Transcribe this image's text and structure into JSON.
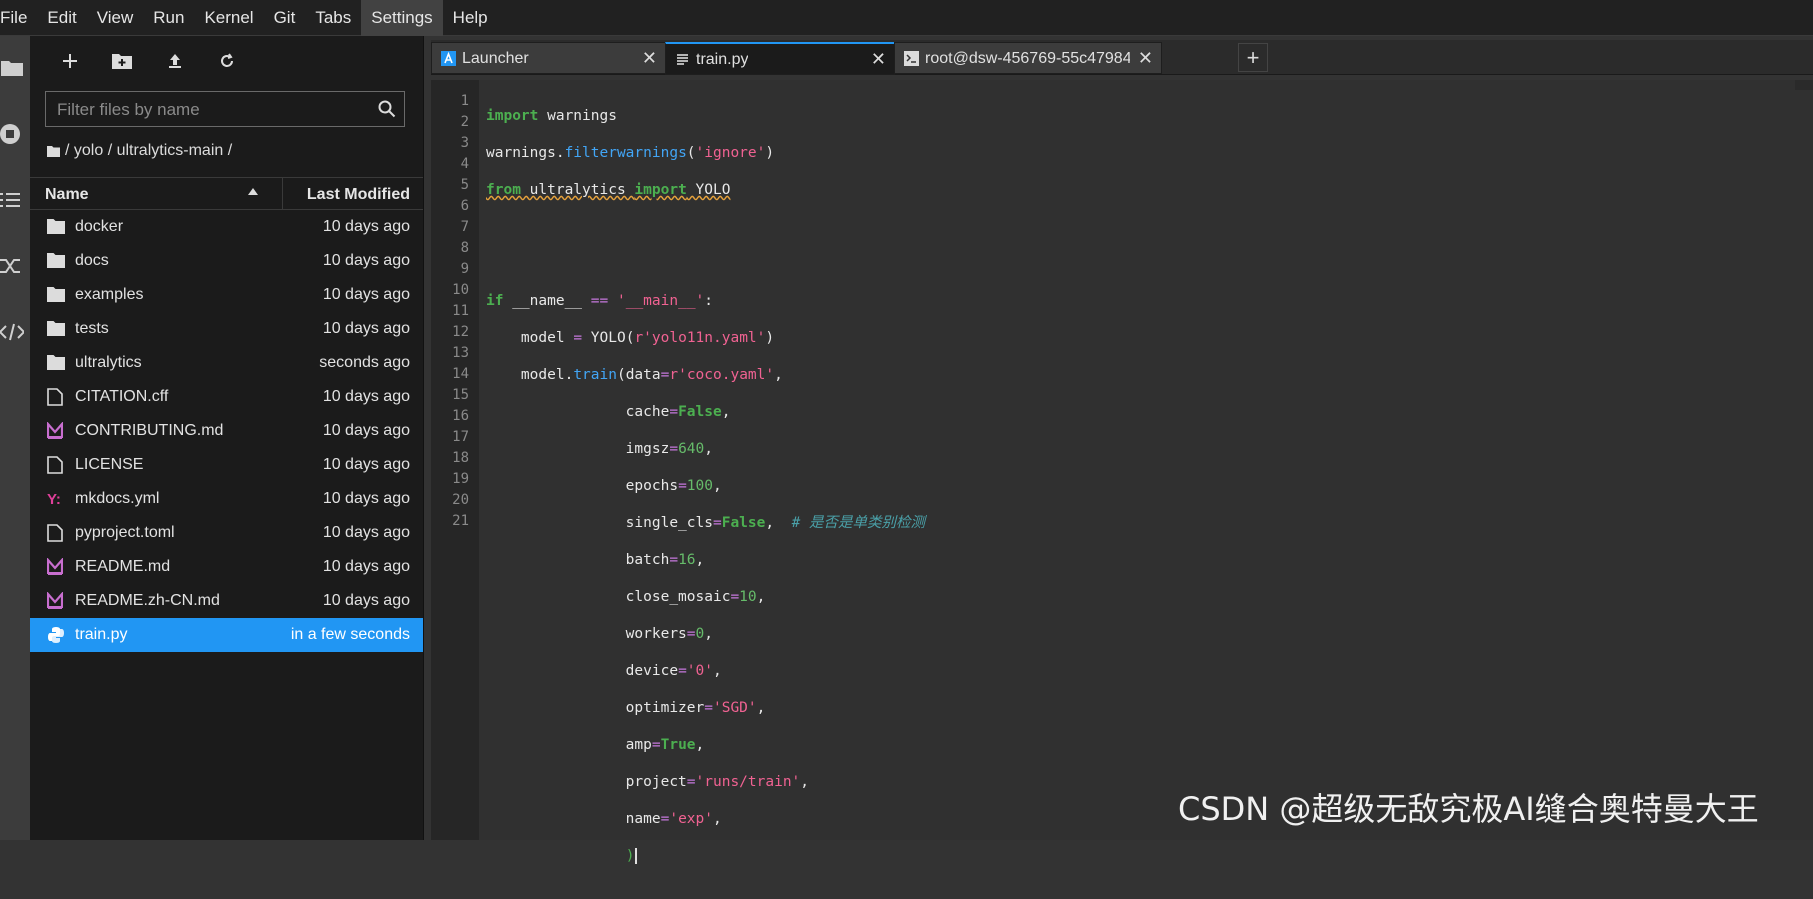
{
  "menu": [
    "File",
    "Edit",
    "View",
    "Run",
    "Kernel",
    "Git",
    "Tabs",
    "Settings",
    "Help"
  ],
  "activity_icons": [
    "folder-icon",
    "running-icon",
    "toc-icon",
    "extension-icon",
    "code-icon"
  ],
  "file_browser": {
    "toolbar": [
      "new-launcher-icon",
      "new-folder-icon",
      "upload-icon",
      "refresh-icon"
    ],
    "search_placeholder": "Filter files by name",
    "breadcrumb": "/ yolo / ultralytics-main /",
    "headers": {
      "name": "Name",
      "modified": "Last Modified"
    },
    "files": [
      {
        "name": "docker",
        "modified": "10 days ago",
        "type": "folder"
      },
      {
        "name": "docs",
        "modified": "10 days ago",
        "type": "folder"
      },
      {
        "name": "examples",
        "modified": "10 days ago",
        "type": "folder"
      },
      {
        "name": "tests",
        "modified": "10 days ago",
        "type": "folder"
      },
      {
        "name": "ultralytics",
        "modified": "seconds ago",
        "type": "folder"
      },
      {
        "name": "CITATION.cff",
        "modified": "10 days ago",
        "type": "file"
      },
      {
        "name": "CONTRIBUTING.md",
        "modified": "10 days ago",
        "type": "markdown"
      },
      {
        "name": "LICENSE",
        "modified": "10 days ago",
        "type": "file"
      },
      {
        "name": "mkdocs.yml",
        "modified": "10 days ago",
        "type": "yaml"
      },
      {
        "name": "pyproject.toml",
        "modified": "10 days ago",
        "type": "file"
      },
      {
        "name": "README.md",
        "modified": "10 days ago",
        "type": "markdown"
      },
      {
        "name": "README.zh-CN.md",
        "modified": "10 days ago",
        "type": "markdown"
      },
      {
        "name": "train.py",
        "modified": "in a few seconds",
        "type": "python",
        "selected": true
      }
    ]
  },
  "tabs": [
    {
      "label": "Launcher",
      "icon": "launcher-icon"
    },
    {
      "label": "train.py",
      "icon": "text-file-icon",
      "active": true
    },
    {
      "label": "root@dsw-456769-55c47984",
      "icon": "terminal-icon"
    }
  ],
  "editor": {
    "line_numbers": [
      "1",
      "2",
      "3",
      "4",
      "5",
      "6",
      "7",
      "8",
      "9",
      "10",
      "11",
      "12",
      "13",
      "14",
      "15",
      "16",
      "17",
      "18",
      "19",
      "20",
      "21"
    ],
    "comment_text": "# 是否是单类别检测"
  },
  "watermark": "CSDN @超级无敌究极AI缝合奥特曼大王",
  "colors": {
    "accent": "#2196f3",
    "keyword": "#4caf50",
    "string": "#f06292",
    "number": "#66bb6a"
  }
}
